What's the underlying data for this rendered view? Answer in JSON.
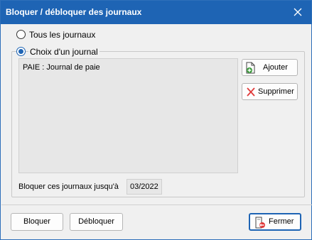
{
  "window": {
    "title": "Bloquer / débloquer des journaux"
  },
  "options": {
    "all_journals": {
      "label": "Tous les journaux",
      "checked": false
    },
    "choose_journal": {
      "label": "Choix d'un journal",
      "checked": true
    }
  },
  "journal_list": {
    "items": [
      "PAIE : Journal de paie"
    ]
  },
  "side_buttons": {
    "add_label": "Ajouter",
    "delete_label": "Supprimer"
  },
  "lock_until": {
    "label": "Bloquer ces journaux jusqu'à",
    "value": "03/2022"
  },
  "footer": {
    "lock_label": "Bloquer",
    "unlock_label": "Débloquer",
    "close_label": "Fermer"
  },
  "colors": {
    "titlebar": "#1e64b4",
    "accent": "#1e64b4",
    "delete_red": "#e03a3a",
    "add_green": "#3a9a3a"
  }
}
